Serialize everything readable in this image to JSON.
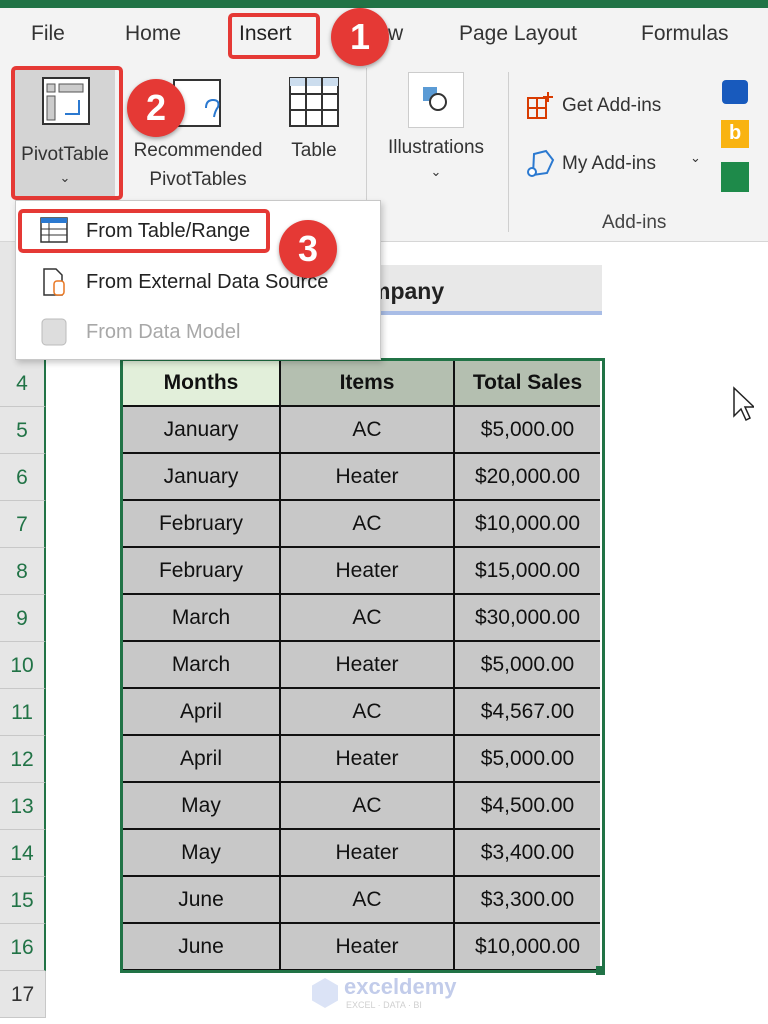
{
  "tabs": [
    "File",
    "Home",
    "Insert",
    "w",
    "Page Layout",
    "Formulas"
  ],
  "ribbon": {
    "pivottable": "PivotTable",
    "recommended_line1": "Recommended",
    "recommended_line2": "PivotTables",
    "table": "Table",
    "illustrations": "Illustrations",
    "get_addins": "Get Add-ins",
    "my_addins": "My Add-ins",
    "addins_group": "Add-ins"
  },
  "steps": [
    "1",
    "2",
    "3"
  ],
  "menu": {
    "items": [
      {
        "label": "From Table/Range",
        "enabled": true
      },
      {
        "label": "From External Data Source",
        "enabled": true
      },
      {
        "label": "From Data Model",
        "enabled": false
      }
    ]
  },
  "sheet": {
    "title_partial": "mpany",
    "row_numbers": [
      "4",
      "5",
      "6",
      "7",
      "8",
      "9",
      "10",
      "11",
      "12",
      "13",
      "14",
      "15",
      "16",
      "17"
    ],
    "headers": [
      "Months",
      "Items",
      "Total Sales"
    ],
    "rows": [
      [
        "January",
        "AC",
        "$5,000.00"
      ],
      [
        "January",
        "Heater",
        "$20,000.00"
      ],
      [
        "February",
        "AC",
        "$10,000.00"
      ],
      [
        "February",
        "Heater",
        "$15,000.00"
      ],
      [
        "March",
        "AC",
        "$30,000.00"
      ],
      [
        "March",
        "Heater",
        "$5,000.00"
      ],
      [
        "April",
        "AC",
        "$4,567.00"
      ],
      [
        "April",
        "Heater",
        "$5,000.00"
      ],
      [
        "May",
        "AC",
        "$4,500.00"
      ],
      [
        "May",
        "Heater",
        "$3,400.00"
      ],
      [
        "June",
        "AC",
        "$3,300.00"
      ],
      [
        "June",
        "Heater",
        "$10,000.00"
      ]
    ]
  },
  "watermark": {
    "name": "exceldemy",
    "tagline": "EXCEL · DATA · BI"
  },
  "colors": {
    "excel_green": "#217346",
    "highlight_red": "#e53935"
  }
}
